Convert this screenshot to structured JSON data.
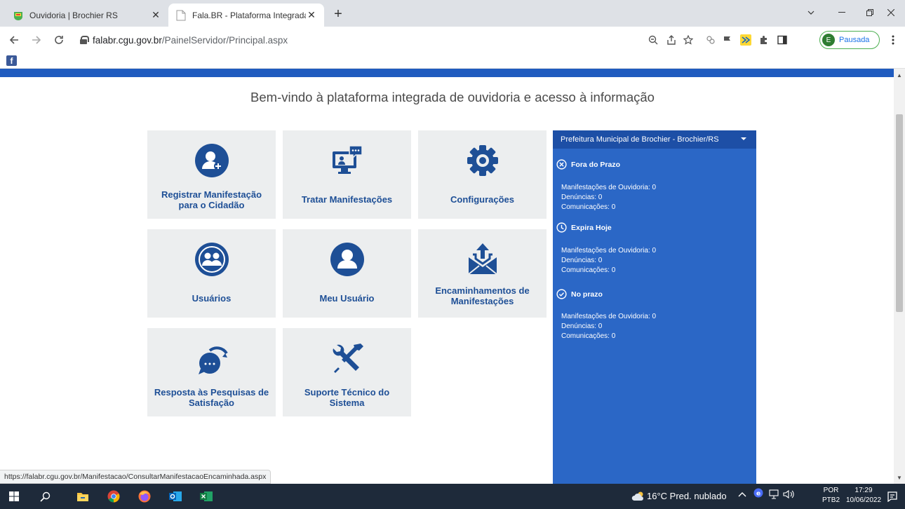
{
  "browser": {
    "tabs": [
      {
        "title": "Ouvidoria | Brochier RS",
        "active": false
      },
      {
        "title": "Fala.BR - Plataforma Integrada de",
        "active": true
      }
    ],
    "new_tab": "+",
    "address": {
      "domain": "falabr.cgu.gov.br",
      "path": "/PainelServidor/Principal.aspx"
    },
    "profile": {
      "initial": "E",
      "status": "Pausada"
    },
    "status_url": "https://falabr.cgu.gov.br/Manifestacao/ConsultarManifestacaoEncaminhada.aspx"
  },
  "page": {
    "welcome": "Bem-vindo à plataforma integrada de ouvidoria e acesso à informação",
    "cards": [
      {
        "label": "Registrar Manifestação para o Cidadão",
        "icon": "add-user-icon"
      },
      {
        "label": "Tratar Manifestações",
        "icon": "monitor-chat-icon"
      },
      {
        "label": "Configurações",
        "icon": "gear-icon"
      },
      {
        "label": "Usuários",
        "icon": "users-icon"
      },
      {
        "label": "Meu Usuário",
        "icon": "user-icon"
      },
      {
        "label": "Encaminhamentos de Manifestações",
        "icon": "mail-forward-icon"
      },
      {
        "label": "Resposta às Pesquisas de Satisfação",
        "icon": "chat-bubble-icon"
      },
      {
        "label": "Suporte Técnico do Sistema",
        "icon": "tools-icon"
      }
    ],
    "panel": {
      "org": "Prefeitura Municipal de Brochier - Brochier/RS",
      "sections": [
        {
          "title": "Fora do Prazo",
          "icon": "x-circle-icon",
          "lines": [
            "Manifestações de Ouvidoria: 0",
            "Denúncias: 0",
            "Comunicações: 0"
          ]
        },
        {
          "title": "Expira Hoje",
          "icon": "clock-icon",
          "lines": [
            "Manifestações de Ouvidoria: 0",
            "Denúncias: 0",
            "Comunicações: 0"
          ]
        },
        {
          "title": "No prazo",
          "icon": "check-circle-icon",
          "lines": [
            "Manifestações de Ouvidoria: 0",
            "Denúncias: 0",
            "Comunicações: 0"
          ]
        }
      ]
    }
  },
  "taskbar": {
    "weather": "16°C  Pred. nublado",
    "lang": [
      "POR",
      "PTB2"
    ],
    "time": "17:29",
    "date": "10/06/2022"
  },
  "colors": {
    "brand_blue": "#1e4f96",
    "panel_blue": "#2b67c6",
    "strip_blue": "#1f5bbf"
  }
}
